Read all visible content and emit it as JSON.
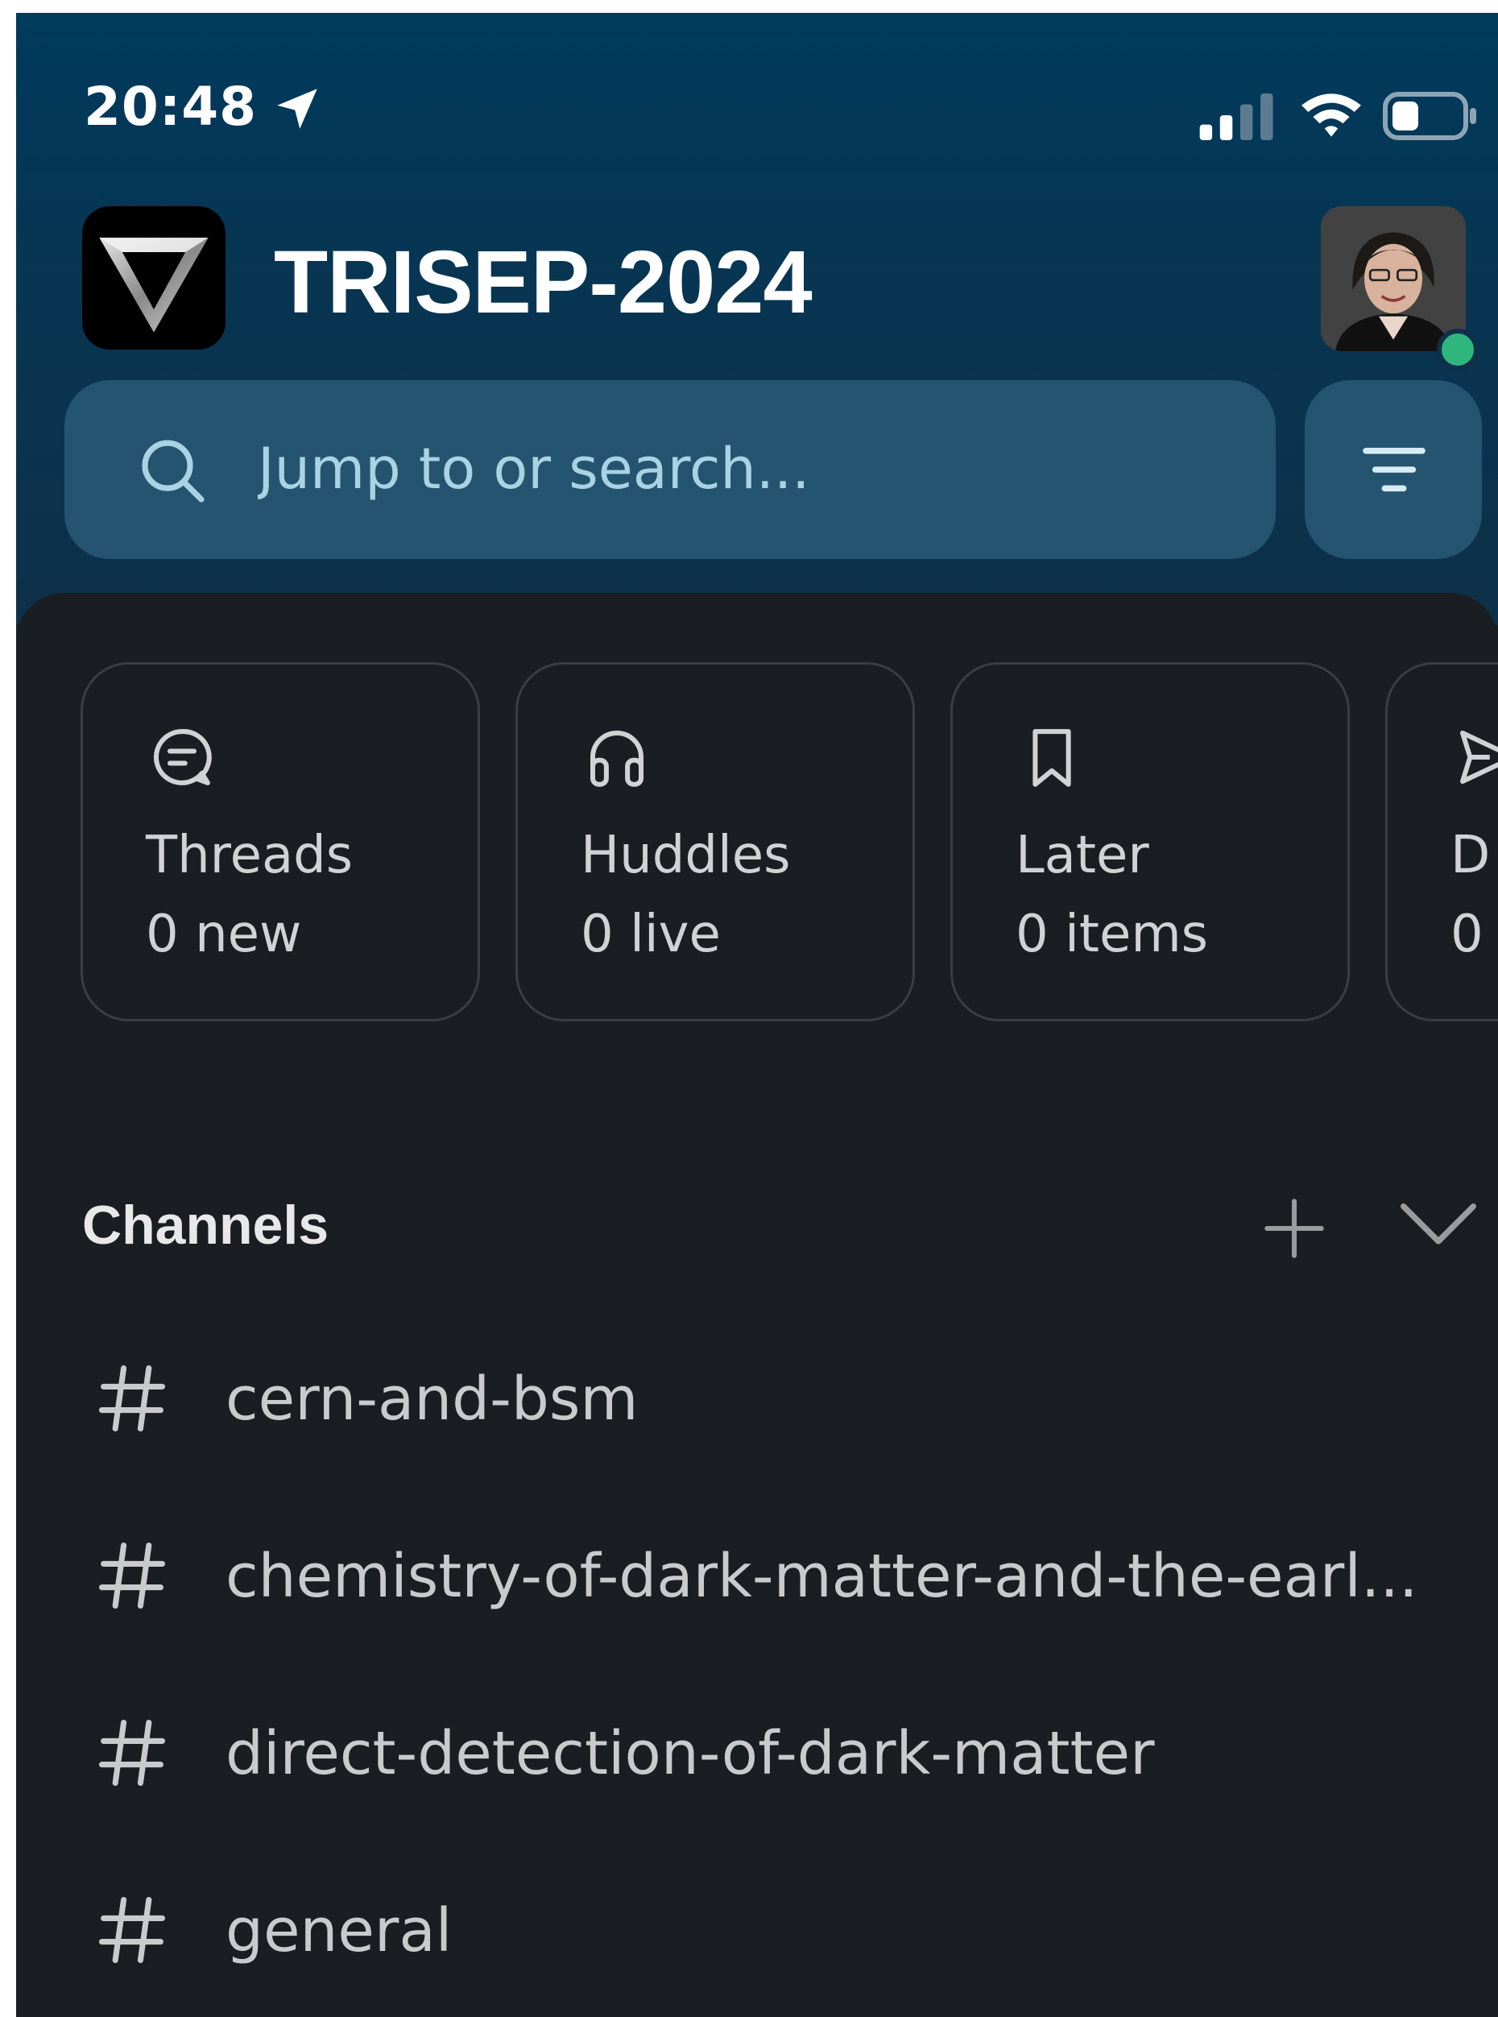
{
  "status_bar": {
    "time": "20:48",
    "icons": [
      "location-arrow-icon",
      "cellular-signal-icon",
      "wifi-icon",
      "battery-icon"
    ]
  },
  "workspace": {
    "name": "TRISEP-2024",
    "logo_icon": "triangle-logo-icon",
    "avatar_icon": "user-avatar",
    "presence_color": "#2eb67d"
  },
  "search": {
    "placeholder": "Jump to or search...",
    "value": ""
  },
  "filter": {
    "icon": "filter-icon"
  },
  "cards": [
    {
      "icon": "threads-icon",
      "title": "Threads",
      "sub": "0 new"
    },
    {
      "icon": "headphones-icon",
      "title": "Huddles",
      "sub": "0 live"
    },
    {
      "icon": "bookmark-icon",
      "title": "Later",
      "sub": "0 items"
    },
    {
      "icon": "send-icon",
      "title": "D",
      "sub": "0"
    }
  ],
  "channels": {
    "title": "Channels",
    "items": [
      {
        "name": "cern-and-bsm"
      },
      {
        "name": "chemistry-of-dark-matter-and-the-earl..."
      },
      {
        "name": "direct-detection-of-dark-matter"
      },
      {
        "name": "general"
      }
    ]
  },
  "colors": {
    "header_top": "#003a5c",
    "header_bottom": "#0e3048",
    "search_bg": "#24546f",
    "sheet_bg": "#1a1d21",
    "card_border": "#3a3d42",
    "text": "#d1d2d3"
  }
}
